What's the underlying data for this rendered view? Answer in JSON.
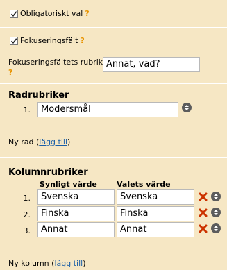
{
  "options": {
    "mandatory": {
      "label": "Obligatoriskt val",
      "checked": true,
      "help": "?"
    },
    "focus": {
      "label": "Fokuseringsfält",
      "checked": true,
      "help": "?"
    },
    "focus_heading": {
      "label": "Fokuseringsfältets rubrik",
      "help": "?",
      "value": "Annat, vad?"
    }
  },
  "rows": {
    "title": "Radrubriker",
    "items": [
      {
        "num": "1.",
        "value": "Modersmål"
      }
    ],
    "add_prefix": "Ny rad (",
    "add_link": "lägg till",
    "add_suffix": ")"
  },
  "columns": {
    "title": "Kolumnrubriker",
    "header_visible": "Synligt värde",
    "header_value": "Valets värde",
    "items": [
      {
        "num": "1.",
        "visible": "Svenska",
        "value": "Svenska"
      },
      {
        "num": "2.",
        "visible": "Finska",
        "value": "Finska"
      },
      {
        "num": "3.",
        "visible": "Annat",
        "value": "Annat"
      }
    ],
    "add_prefix": "Ny kolumn (",
    "add_link": "lägg till",
    "add_suffix": ")"
  },
  "colors": {
    "background": "#f6e7c4",
    "help": "#e89400",
    "delete": "#cc3300",
    "link": "#1a5fa8"
  },
  "icons": [
    "checkmark-icon",
    "sort-arrows-icon",
    "delete-x-icon"
  ]
}
